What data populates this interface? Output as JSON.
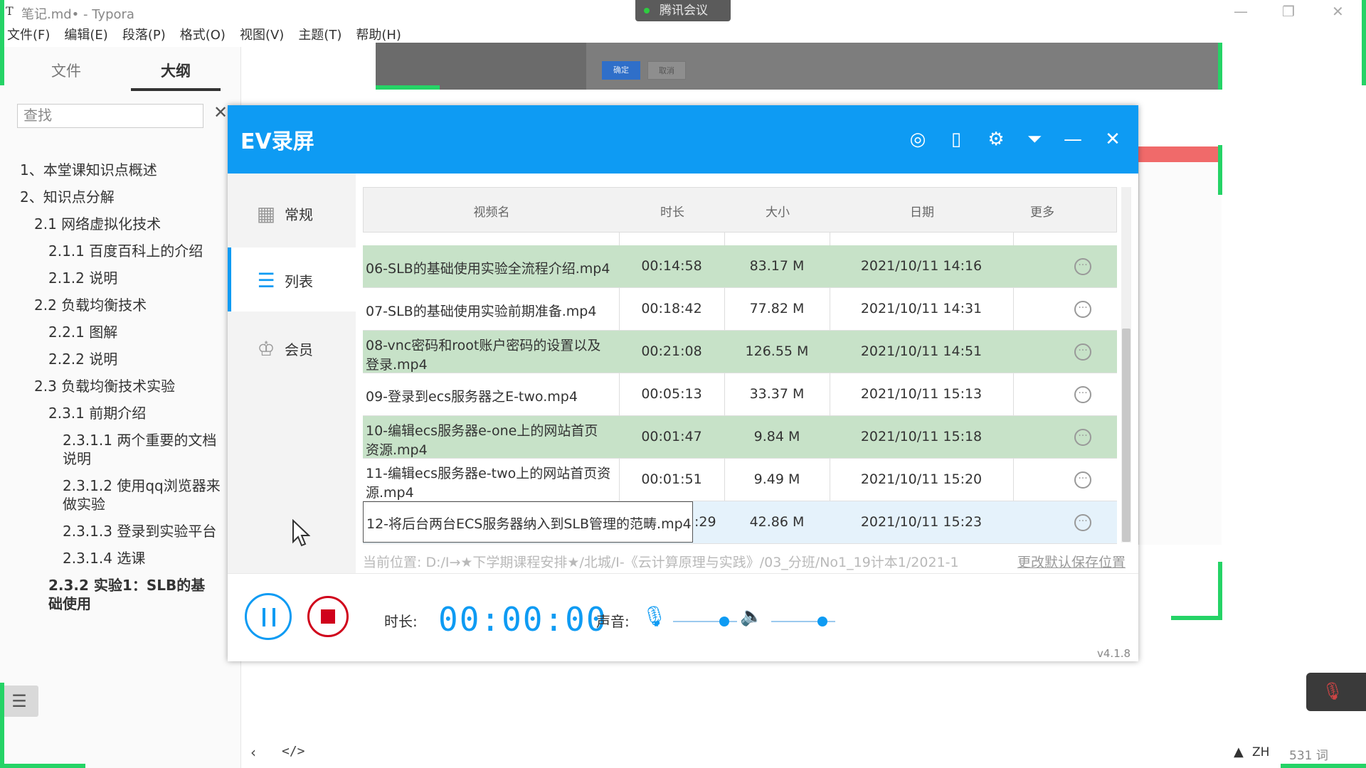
{
  "typora": {
    "title": "笔记.md• - Typora",
    "icon": "T",
    "menu": [
      "文件(F)",
      "编辑(E)",
      "段落(P)",
      "格式(O)",
      "视图(V)",
      "主题(T)",
      "帮助(H)"
    ],
    "tabs": {
      "files": "文件",
      "outline": "大纲"
    },
    "search_placeholder": "查找",
    "outline": [
      {
        "text": "1、本堂课知识点概述",
        "level": 1
      },
      {
        "text": "2、知识点分解",
        "level": 1
      },
      {
        "text": "2.1 网络虚拟化技术",
        "level": 2
      },
      {
        "text": "2.1.1 百度百科上的介绍",
        "level": 3
      },
      {
        "text": "2.1.2 说明",
        "level": 3
      },
      {
        "text": "2.2 负载均衡技术",
        "level": 2
      },
      {
        "text": "2.2.1 图解",
        "level": 3
      },
      {
        "text": "2.2.2 说明",
        "level": 3
      },
      {
        "text": "2.3 负载均衡技术实验",
        "level": 2
      },
      {
        "text": "2.3.1 前期介绍",
        "level": 3
      },
      {
        "text": "2.3.1.1 两个重要的文档说明",
        "level": 4
      },
      {
        "text": "2.3.1.2 使用qq浏览器来做实验",
        "level": 4
      },
      {
        "text": "2.3.1.3 登录到实验平台",
        "level": 4
      },
      {
        "text": "2.3.1.4 选课",
        "level": 4
      },
      {
        "text": "2.3.2 实验1：SLB的基础使用",
        "level": 3,
        "active": true
      }
    ],
    "status": {
      "lang": "ZH",
      "words": "531 词"
    }
  },
  "meeting": {
    "label": "腾讯会议"
  },
  "background": {
    "ok": "确定",
    "cancel": "取消"
  },
  "ev": {
    "title": "EV录屏",
    "header_icons": [
      "user-icon",
      "clipboard-icon",
      "gear-icon",
      "collapse-icon",
      "minimize-icon",
      "close-icon"
    ],
    "nav": [
      {
        "label": "常规",
        "icon": "grid-icon"
      },
      {
        "label": "列表",
        "icon": "list-icon",
        "active": true
      },
      {
        "label": "会员",
        "icon": "crown-icon"
      }
    ],
    "columns": [
      "视频名",
      "时长",
      "大小",
      "日期",
      "更多"
    ],
    "rows": [
      {
        "name": "06-SLB的基础使用实验全流程介绍.mp4",
        "duration": "00:14:58",
        "size": "83.17 M",
        "date": "2021/10/11 14:16",
        "style": "green"
      },
      {
        "name": "07-SLB的基础使用实验前期准备.mp4",
        "duration": "00:18:42",
        "size": "77.82 M",
        "date": "2021/10/11 14:31",
        "style": "white"
      },
      {
        "name": "08-vnc密码和root账户密码的设置以及登录.mp4",
        "duration": "00:21:08",
        "size": "126.55 M",
        "date": "2021/10/11 14:51",
        "style": "green"
      },
      {
        "name": "09-登录到ecs服务器之E-two.mp4",
        "duration": "00:05:13",
        "size": "33.37 M",
        "date": "2021/10/11 15:13",
        "style": "white"
      },
      {
        "name": "10-编辑ecs服务器e-one上的网站首页资源.mp4",
        "duration": "00:01:47",
        "size": "9.84 M",
        "date": "2021/10/11 15:18",
        "style": "green"
      },
      {
        "name": "11-编辑ecs服务器e-two上的网站首页资源.mp4",
        "duration": "00:01:51",
        "size": "9.49 M",
        "date": "2021/10/11 15:20",
        "style": "white"
      },
      {
        "name": "12-将后台两台ECS服务器纳入到SLB管理的范畴.mp4",
        "duration": ":29",
        "size": "42.86 M",
        "date": "2021/10/11 15:23",
        "style": "selected"
      }
    ],
    "save_path": "当前位置: D:/Ⅰ→★下学期课程安排★/北城/Ⅰ-《云计算原理与实践》/03_分班/No1_19计本1/2021-1",
    "change_save": "更改默认保存位置",
    "duration_label": "时长:",
    "duration_value": "00:00:00",
    "volume_label": "声音:",
    "mic_level": 0.85,
    "speaker_level": 0.85,
    "version": "v4.1.8"
  }
}
